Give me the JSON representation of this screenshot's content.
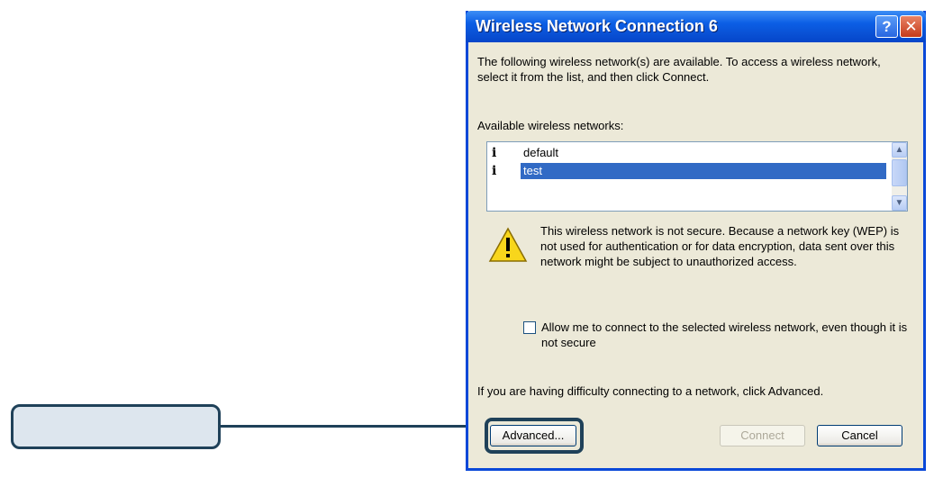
{
  "dialog": {
    "title": "Wireless Network Connection 6",
    "help_symbol": "?",
    "close_symbol": "✕",
    "intro": "The following wireless network(s) are available. To access a wireless network, select it from the list, and then click Connect.",
    "available_label": "Available wireless networks:",
    "networks": [
      {
        "label": "default",
        "icon": "info-icon",
        "selected": false
      },
      {
        "label": "test",
        "icon": "info-icon",
        "selected": true
      }
    ],
    "warning": "This wireless network is not secure. Because a network key (WEP) is not used for authentication or for data encryption, data sent over this network might be subject to unauthorized access.",
    "allow_checkbox_label": "Allow me to connect to the selected wireless network, even though it is not secure",
    "allow_checked": false,
    "help_text": "If you are having difficulty connecting to a network, click Advanced.",
    "buttons": {
      "advanced": "Advanced...",
      "connect": "Connect",
      "cancel": "Cancel"
    }
  },
  "colors": {
    "callout": "#1f4159",
    "titlebar": "#0a52d6",
    "selection": "#316ac5"
  }
}
